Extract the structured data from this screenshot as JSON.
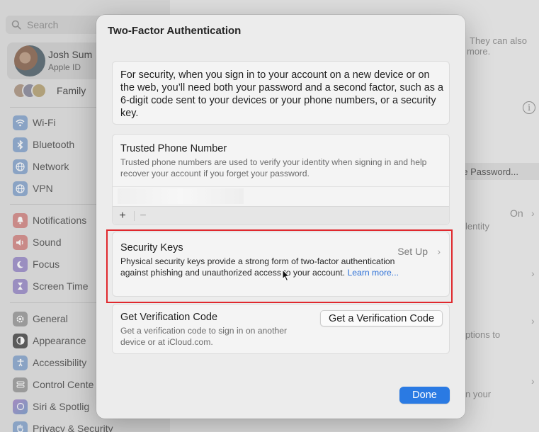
{
  "sidebar": {
    "search_placeholder": "Search",
    "user": {
      "name": "Josh Sum",
      "subtitle": "Apple ID"
    },
    "family_label": "Family",
    "items": [
      {
        "label": "Wi-Fi",
        "icon": "wifi-icon",
        "color": "#8aa3c4"
      },
      {
        "label": "Bluetooth",
        "icon": "bluetooth-icon",
        "color": "#8aa3c4"
      },
      {
        "label": "Network",
        "icon": "globe-icon",
        "color": "#8aa3c4"
      },
      {
        "label": "VPN",
        "icon": "vpn-globe-icon",
        "color": "#8aa3c4"
      },
      {
        "label": "Notifications",
        "icon": "bell-icon",
        "color": "#c98a88"
      },
      {
        "label": "Sound",
        "icon": "speaker-icon",
        "color": "#c98a88"
      },
      {
        "label": "Focus",
        "icon": "moon-icon",
        "color": "#9a8ec0"
      },
      {
        "label": "Screen Time",
        "icon": "hourglass-icon",
        "color": "#9a8ec0"
      },
      {
        "label": "General",
        "icon": "gear-icon",
        "color": "#9a9a9a"
      },
      {
        "label": "Appearance",
        "icon": "appearance-icon",
        "color": "#5a5a5a"
      },
      {
        "label": "Accessibility",
        "icon": "accessibility-icon",
        "color": "#8aa3c4"
      },
      {
        "label": "Control Cente",
        "icon": "control-center-icon",
        "color": "#9a9a9a"
      },
      {
        "label": "Siri & Spotlig",
        "icon": "siri-icon",
        "color": "#a48ac0"
      },
      {
        "label": "Privacy & Security",
        "icon": "hand-icon",
        "color": "#8aa3c4"
      }
    ]
  },
  "background_content": {
    "they_can_also": "They can also",
    "more": "more.",
    "change_password": "ge Password...",
    "on": "On",
    "identity": "lentity",
    "options_to": "ptions to",
    "in_your": "n your"
  },
  "dialog": {
    "title": "Two-Factor Authentication",
    "intro": "For security, when you sign in to your account on a new device or on the web, you’ll need both your password and a second factor, such as a 6-digit code sent to your devices or your phone numbers, or a security key.",
    "trusted_phone": {
      "title": "Trusted Phone Number",
      "description": "Trusted phone numbers are used to verify your identity when signing in and help recover your account if you forget your password.",
      "add_label": "+",
      "remove_label": "−"
    },
    "security_keys": {
      "title": "Security Keys",
      "setup_label": "Set Up",
      "description": "Physical security keys provide a strong form of two-factor authentication against phishing and unauthorized access to your account.",
      "learn_more": "Learn more..."
    },
    "verification": {
      "title": "Get Verification Code",
      "description": "Get a verification code to sign in on another device or at iCloud.com.",
      "button_label": "Get a Verification Code"
    },
    "done_label": "Done"
  },
  "colors": {
    "accent": "#2a7ae3",
    "highlight": "#e0282d",
    "link": "#2b6fd6"
  }
}
